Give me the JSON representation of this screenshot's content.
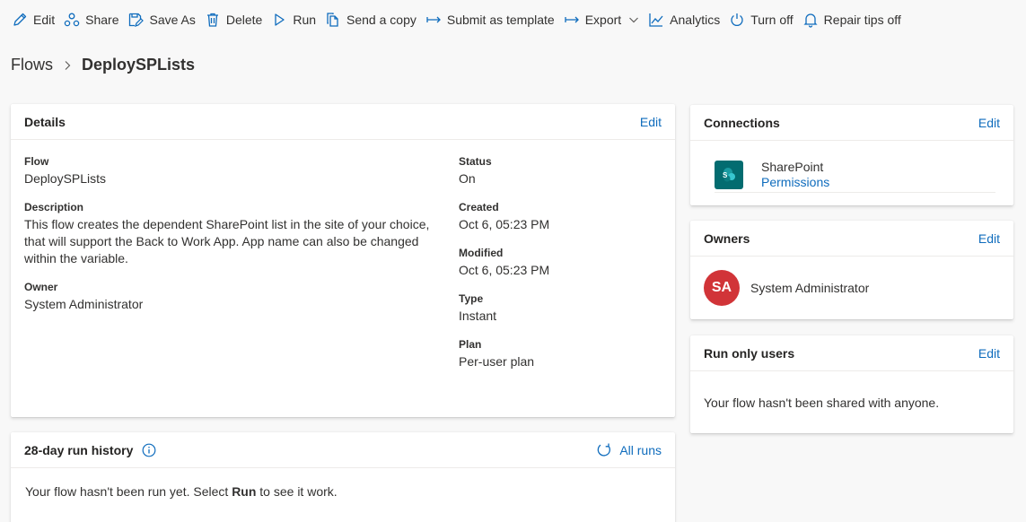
{
  "toolbar": {
    "edit": "Edit",
    "share": "Share",
    "save_as": "Save As",
    "delete": "Delete",
    "run": "Run",
    "send_copy": "Send a copy",
    "submit_template": "Submit as template",
    "export": "Export",
    "analytics": "Analytics",
    "turn_off": "Turn off",
    "repair_tips": "Repair tips off"
  },
  "breadcrumb": {
    "parent": "Flows",
    "current": "DeploySPLists"
  },
  "details": {
    "title": "Details",
    "edit": "Edit",
    "flow_label": "Flow",
    "flow_value": "DeploySPLists",
    "description_label": "Description",
    "description_value": "This flow creates the dependent SharePoint list in the site of your choice, that will support the Back to Work App. App name can also be changed within the variable.",
    "owner_label": "Owner",
    "owner_value": "System Administrator",
    "status_label": "Status",
    "status_value": "On",
    "created_label": "Created",
    "created_value": "Oct 6, 05:23 PM",
    "modified_label": "Modified",
    "modified_value": "Oct 6, 05:23 PM",
    "type_label": "Type",
    "type_value": "Instant",
    "plan_label": "Plan",
    "plan_value": "Per-user plan"
  },
  "run_history": {
    "title": "28-day run history",
    "all_runs": "All runs",
    "message_pre": "Your flow hasn't been run yet. Select ",
    "message_bold": "Run",
    "message_post": " to see it work."
  },
  "connections": {
    "title": "Connections",
    "edit": "Edit",
    "items": [
      {
        "name": "SharePoint",
        "link": "Permissions",
        "icon": "sharepoint-logo-icon"
      }
    ]
  },
  "owners": {
    "title": "Owners",
    "edit": "Edit",
    "items": [
      {
        "initials": "SA",
        "name": "System Administrator"
      }
    ]
  },
  "run_only_users": {
    "title": "Run only users",
    "edit": "Edit",
    "message": "Your flow hasn't been shared with anyone."
  },
  "colors": {
    "accent": "#0f6cbd",
    "avatar": "#d13438",
    "sharepoint": "#036c70"
  }
}
